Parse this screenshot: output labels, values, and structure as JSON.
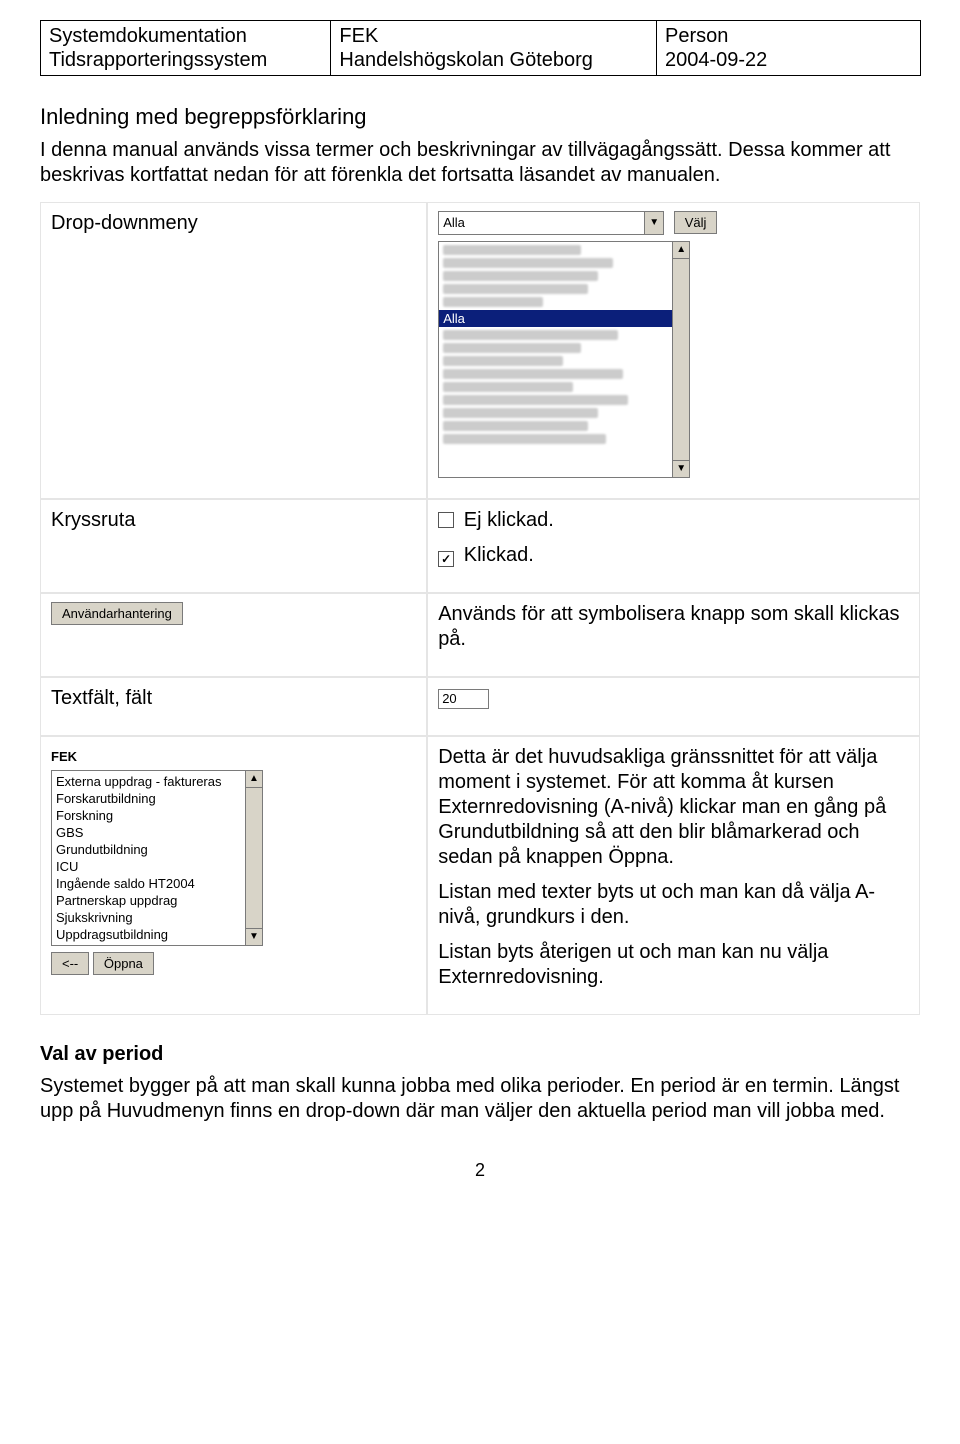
{
  "header": {
    "c1a": "Systemdokumentation",
    "c1b": "Tidsrapporteringssystem",
    "c2a": "FEK",
    "c2b": "Handelshögskolan Göteborg",
    "c3a": "Person",
    "c3b": "2004-09-22"
  },
  "intro": {
    "heading": "Inledning med begreppsförklaring",
    "text": "I denna manual används vissa termer och beskrivningar av tillvägagångssätt. Dessa kommer att beskrivas kortfattat nedan för att förenkla det fortsatta läsandet av manualen."
  },
  "rows": {
    "dropdown_label": "Drop-downmeny",
    "dropdown_selected": "Alla",
    "dropdown_valj": "Välj",
    "listbox_hl": "Alla",
    "kryssruta_label": "Kryssruta",
    "ej_klickad": "Ej klickad.",
    "klickad": "Klickad.",
    "anvandarhanterin_btn": "Användarhantering",
    "anvandarhanterin_desc": "Används för att symbolisera knapp som skall klickas på.",
    "textfalt_label": "Textfält, fält",
    "textfalt_value": "20",
    "fek_label": "FEK",
    "fek_items": [
      "Externa uppdrag - faktureras",
      "Forskarutbildning",
      "Forskning",
      "GBS",
      "Grundutbildning",
      "ICU",
      "Ingående saldo HT2004",
      "Partnerskap uppdrag",
      "Sjukskrivning",
      "Uppdragsutbildning"
    ],
    "fek_back": "<--",
    "fek_open": "Öppna",
    "fek_desc1": "Detta är det huvudsakliga gränssnittet för att välja moment i systemet. För att komma åt kursen Externredovisning (A-nivå) klickar man en gång på Grundutbildning så att den blir blåmarkerad och sedan på knappen Öppna.",
    "fek_desc2": "Listan med texter byts ut och man kan då välja A-nivå, grundkurs i den.",
    "fek_desc3": "Listan byts återigen ut och man kan nu välja Externredovisning."
  },
  "val_av_period": {
    "heading": "Val av period",
    "text": "Systemet bygger på att man skall kunna jobba med olika perioder. En period är en termin. Längst upp på Huvudmenyn finns en drop-down där man väljer den aktuella period man vill jobba med."
  },
  "pagenum": "2"
}
